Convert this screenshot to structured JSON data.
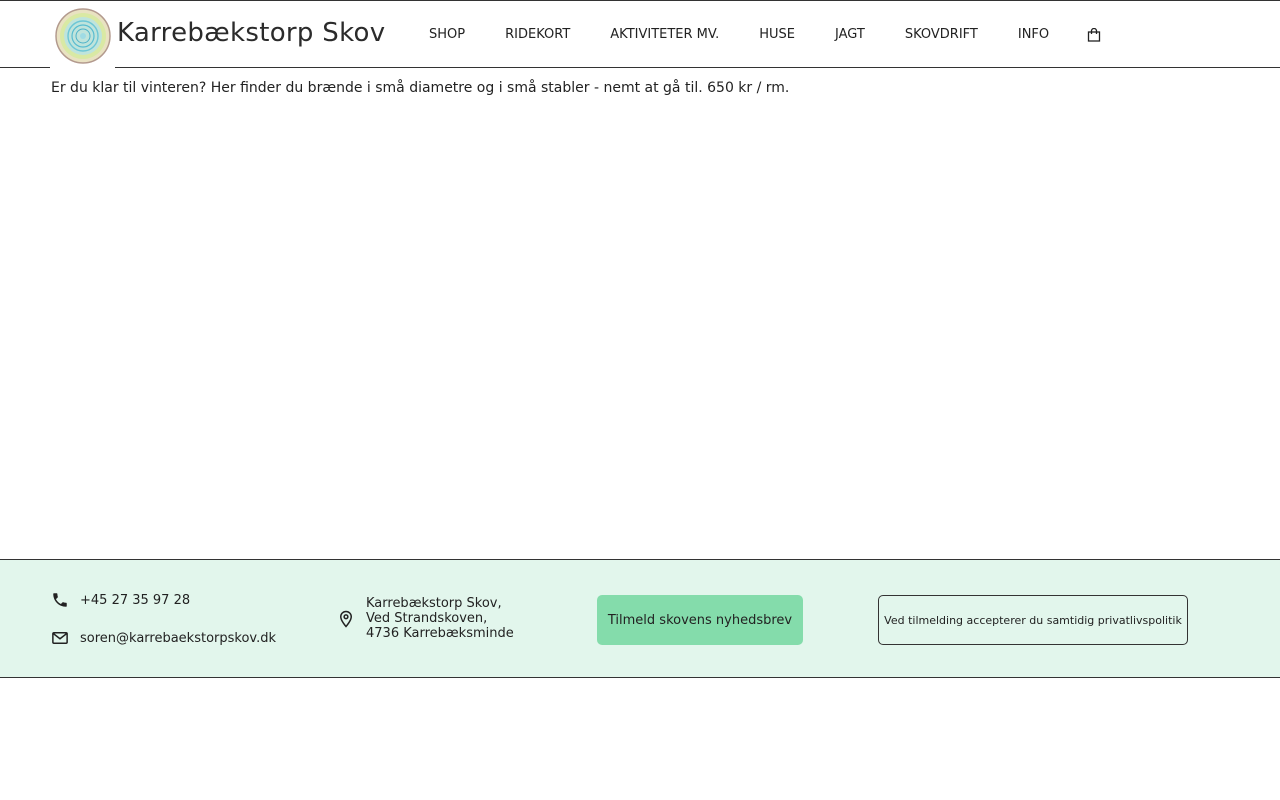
{
  "header": {
    "site_title": "Karrebækstorp Skov",
    "logo_icon": "tree-ring-logo",
    "nav": [
      {
        "label": "SHOP"
      },
      {
        "label": "RIDEKORT"
      },
      {
        "label": "AKTIVITETER MV."
      },
      {
        "label": "HUSE"
      },
      {
        "label": "JAGT"
      },
      {
        "label": "SKOVDRIFT"
      },
      {
        "label": "INFO"
      }
    ],
    "cart_icon": "shopping-bag-icon"
  },
  "main": {
    "intro_text": "Er du klar til vinteren? Her finder du brænde i små diametre og i små stabler - nemt at gå til. 650 kr / rm."
  },
  "footer": {
    "phone": "+45 27 35 97 28",
    "email": "soren@karrebaekstorpskov.dk",
    "address": [
      "Karrebækstorp Skov,",
      "Ved Strandskoven,",
      "4736 Karrebæksminde"
    ],
    "newsletter_button": "Tilmeld skovens nyhedsbrev",
    "privacy_text": "Ved tilmelding accepterer du samtidig privatlivspolitik"
  },
  "colors": {
    "footer_bg": "#e2f6ec",
    "button_bg": "#84dcab",
    "text": "#222222"
  }
}
